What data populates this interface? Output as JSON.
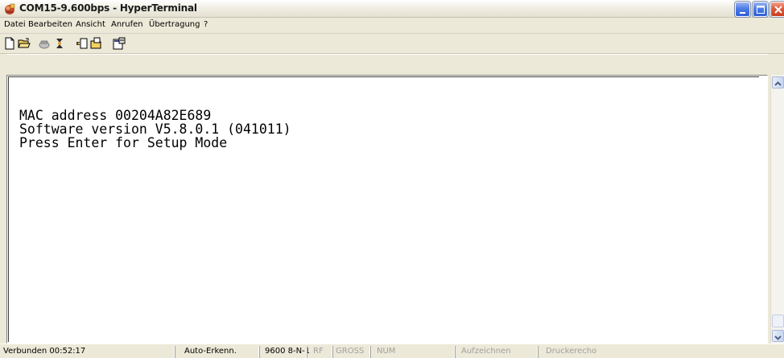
{
  "window": {
    "title": "COM15-9.600bps - HyperTerminal"
  },
  "menu": {
    "items": [
      "Datei",
      "Bearbeiten",
      "Ansicht",
      "Anrufen",
      "Übertragung",
      "?"
    ]
  },
  "toolbar": {
    "icons": [
      "new-file-icon",
      "open-folder-icon",
      "connect-phone-icon",
      "disconnect-icon",
      "send-file-icon",
      "receive-file-icon",
      "properties-icon"
    ]
  },
  "terminal": {
    "lines": [
      "MAC address 00204A82E689",
      "Software version V5.8.0.1 (041011)",
      "Press Enter for Setup Mode"
    ]
  },
  "status": {
    "connected": "Verbunden 00:52:17",
    "detect": "Auto-Erkenn.",
    "settings": "9600 8-N-1",
    "scroll": "RF",
    "caps": "GROSS",
    "num": "NUM",
    "capture": "Aufzeichnen",
    "printecho": "Druckerecho"
  },
  "colors": {
    "title_bar": "#ece9d8",
    "close_button": "#e0583a",
    "window_button": "#4d7ce6"
  }
}
